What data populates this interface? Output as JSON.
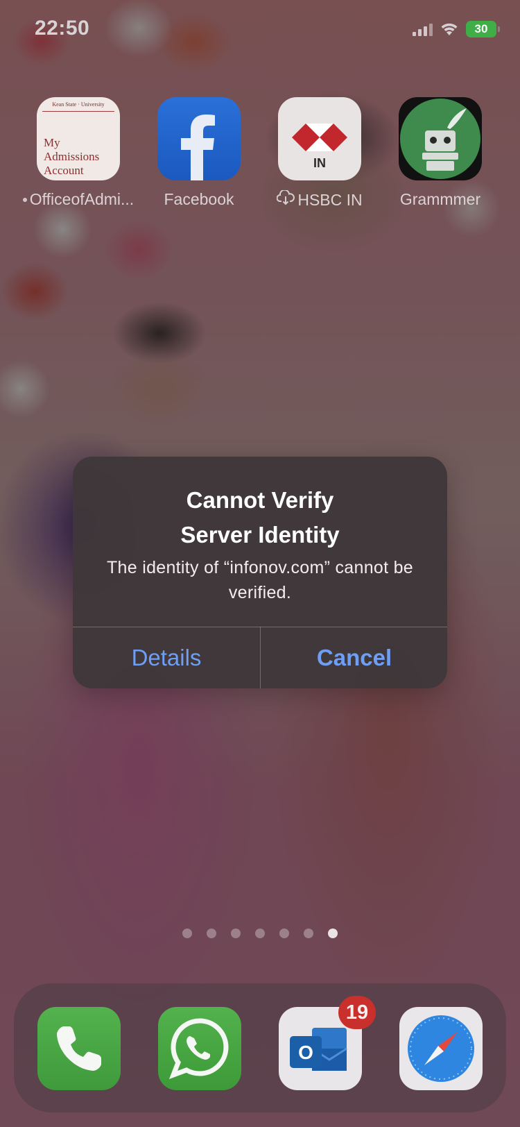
{
  "status_bar": {
    "time": "22:50",
    "battery_percent": "30"
  },
  "apps": [
    {
      "label": "OfficeofAdmi...",
      "icon": "admissions-icon",
      "icon_topline": "Kean State · University",
      "icon_text_line1": "My",
      "icon_text_line2": "Admissions",
      "icon_text_line3": "Account",
      "has_dot": true
    },
    {
      "label": "Facebook",
      "icon": "facebook-icon"
    },
    {
      "label": "HSBC IN",
      "icon": "hsbc-icon",
      "icon_sub": "IN",
      "downloading": true
    },
    {
      "label": "Grammmer",
      "icon": "grammmer-icon"
    }
  ],
  "alert": {
    "title_line1": "Cannot Verify",
    "title_line2": "Server Identity",
    "message": "The identity of “infonov.com” cannot be verified.",
    "details_label": "Details",
    "cancel_label": "Cancel"
  },
  "page_dots": {
    "count": 7,
    "active_index": 6
  },
  "dock": {
    "apps": [
      {
        "name": "Phone",
        "icon": "phone-icon"
      },
      {
        "name": "WhatsApp",
        "icon": "whatsapp-icon"
      },
      {
        "name": "Outlook",
        "icon": "outlook-icon",
        "badge": "19"
      },
      {
        "name": "Safari",
        "icon": "safari-icon"
      }
    ]
  },
  "colors": {
    "alert_button": "#6e9ff5",
    "badge": "#c9302c",
    "battery": "#3fae47"
  }
}
